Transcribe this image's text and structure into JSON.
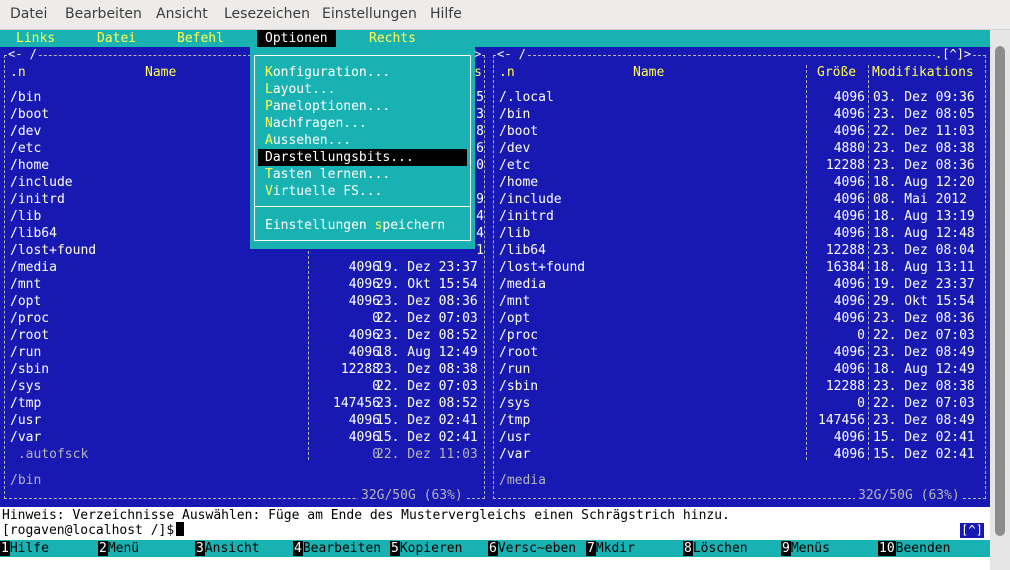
{
  "window_menu": [
    "Datei",
    "Bearbeiten",
    "Ansicht",
    "Lesezeichen",
    "Einstellungen",
    "Hilfe"
  ],
  "mc_menu": {
    "items": [
      "Links",
      "Datei",
      "Befehl",
      "Optionen",
      "Rechts"
    ],
    "selected": "Optionen"
  },
  "dropdown": {
    "items": [
      {
        "hotkey": "K",
        "rest": "onfiguration..."
      },
      {
        "hotkey": "L",
        "rest": "ayout..."
      },
      {
        "hotkey": "P",
        "rest": "aneloptionen..."
      },
      {
        "hotkey": "N",
        "rest": "achfragen..."
      },
      {
        "hotkey": "A",
        "rest": "ussehen..."
      },
      {
        "label": "Darstellungsbits...",
        "selected": true
      },
      {
        "hotkey": "T",
        "rest": "asten lernen..."
      },
      {
        "hotkey": "V",
        "rest": "irtuelle FS..."
      }
    ],
    "save": {
      "pre": "Einstellungen ",
      "hotkey": "s",
      "post": "peichern"
    }
  },
  "left_panel": {
    "top_left": "<- /",
    "top_right": ">",
    "col_sort": ".n",
    "col_name": "Name",
    "col_size_tail": "s",
    "rows": [
      {
        "name": "/bin",
        "size": "",
        "date": "",
        "tail": "5"
      },
      {
        "name": "/boot",
        "size": "",
        "date": "",
        "tail": "3"
      },
      {
        "name": "/dev",
        "size": "",
        "date": "",
        "tail": "8"
      },
      {
        "name": "/etc",
        "size": "",
        "date": "",
        "tail": "6"
      },
      {
        "name": "/home",
        "size": "",
        "date": "",
        "tail": "0"
      },
      {
        "name": "/include",
        "size": "",
        "date": "",
        "tail": ""
      },
      {
        "name": "/initrd",
        "size": "",
        "date": "",
        "tail": "9"
      },
      {
        "name": "/lib",
        "size": "",
        "date": "",
        "tail": "4"
      },
      {
        "name": "/lib64",
        "size": "",
        "date": "",
        "tail": "4"
      },
      {
        "name": "/lost+found",
        "size": "",
        "date": "",
        "tail": "1"
      },
      {
        "name": "/media",
        "size": "4096",
        "date": "19. Dez 23:37"
      },
      {
        "name": "/mnt",
        "size": "4096",
        "date": "29. Okt 15:54"
      },
      {
        "name": "/opt",
        "size": "4096",
        "date": "23. Dez 08:36"
      },
      {
        "name": "/proc",
        "size": "0",
        "date": "22. Dez 07:03"
      },
      {
        "name": "/root",
        "size": "4096",
        "date": "23. Dez 08:52"
      },
      {
        "name": "/run",
        "size": "4096",
        "date": "18. Aug 12:49"
      },
      {
        "name": "/sbin",
        "size": "12288",
        "date": "23. Dez 08:38"
      },
      {
        "name": "/sys",
        "size": "0",
        "date": "22. Dez 07:03"
      },
      {
        "name": "/tmp",
        "size": "147456",
        "date": "23. Dez 08:52"
      },
      {
        "name": "/usr",
        "size": "4096",
        "date": "15. Dez 02:41"
      },
      {
        "name": "/var",
        "size": "4096",
        "date": "15. Dez 02:41"
      },
      {
        "name": " .autofsck",
        "size": "0",
        "date": "22. Dez 11:03",
        "dim": true
      }
    ],
    "status": "/bin",
    "usage": "32G/50G (63%)"
  },
  "right_panel": {
    "top_left": "<- /",
    "top_right": ".[^]>",
    "col_sort": ".n",
    "col_name": "Name",
    "col_size": "Größe",
    "col_date": "Modifikations",
    "rows": [
      {
        "name": "/.local",
        "size": "4096",
        "date": "03. Dez 09:36"
      },
      {
        "name": "/bin",
        "size": "4096",
        "date": "23. Dez 08:05"
      },
      {
        "name": "/boot",
        "size": "4096",
        "date": "22. Dez 11:03"
      },
      {
        "name": "/dev",
        "size": "4880",
        "date": "23. Dez 08:38"
      },
      {
        "name": "/etc",
        "size": "12288",
        "date": "23. Dez 08:36"
      },
      {
        "name": "/home",
        "size": "4096",
        "date": "18. Aug 12:20"
      },
      {
        "name": "/include",
        "size": "4096",
        "date": "08. Mai 2012"
      },
      {
        "name": "/initrd",
        "size": "4096",
        "date": "18. Aug 13:19"
      },
      {
        "name": "/lib",
        "size": "4096",
        "date": "18. Aug 12:48"
      },
      {
        "name": "/lib64",
        "size": "12288",
        "date": "23. Dez 08:04"
      },
      {
        "name": "/lost+found",
        "size": "16384",
        "date": "18. Aug 13:11"
      },
      {
        "name": "/media",
        "size": "4096",
        "date": "19. Dez 23:37"
      },
      {
        "name": "/mnt",
        "size": "4096",
        "date": "29. Okt 15:54"
      },
      {
        "name": "/opt",
        "size": "4096",
        "date": "23. Dez 08:36"
      },
      {
        "name": "/proc",
        "size": "0",
        "date": "22. Dez 07:03"
      },
      {
        "name": "/root",
        "size": "4096",
        "date": "23. Dez 08:49"
      },
      {
        "name": "/run",
        "size": "4096",
        "date": "18. Aug 12:49"
      },
      {
        "name": "/sbin",
        "size": "12288",
        "date": "23. Dez 08:38"
      },
      {
        "name": "/sys",
        "size": "0",
        "date": "22. Dez 07:03"
      },
      {
        "name": "/tmp",
        "size": "147456",
        "date": "23. Dez 08:49"
      },
      {
        "name": "/usr",
        "size": "4096",
        "date": "15. Dez 02:41"
      },
      {
        "name": "/var",
        "size": "4096",
        "date": "15. Dez 02:41"
      }
    ],
    "status": "/media",
    "usage": "32G/50G (63%)"
  },
  "hint": "Hinweis: Verzeichnisse Auswählen: Füge am Ende des Mustervergleichs einen Schrägstrich hinzu.",
  "prompt": "[rogaven@localhost /]$",
  "history_button": "[^]",
  "fkeys": [
    {
      "num": "1",
      "label": "Hilfe"
    },
    {
      "num": "2",
      "label": "Menü"
    },
    {
      "num": "3",
      "label": "Ansicht"
    },
    {
      "num": "4",
      "label": "Bearbeiten"
    },
    {
      "num": "5",
      "label": "Kopieren"
    },
    {
      "num": "6",
      "label": "Versc~eben"
    },
    {
      "num": "7",
      "label": "Mkdir"
    },
    {
      "num": "8",
      "label": "Löschen"
    },
    {
      "num": "9",
      "label": "Menüs"
    },
    {
      "num": "10",
      "label": "Beenden"
    }
  ]
}
